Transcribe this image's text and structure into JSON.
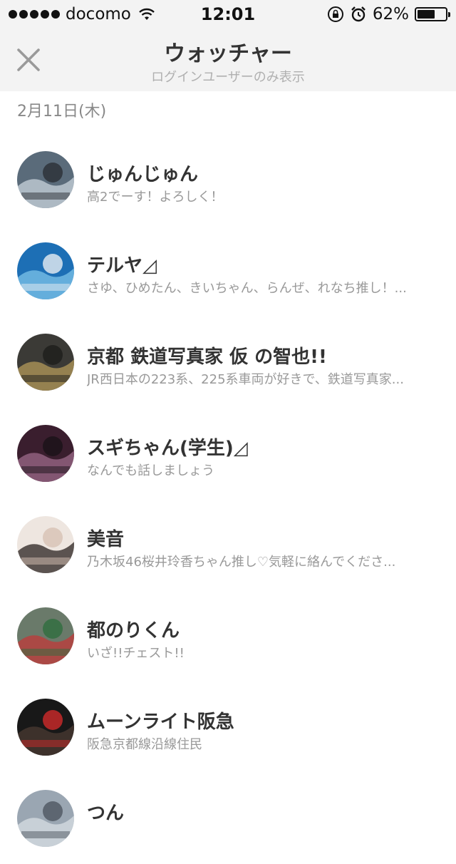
{
  "status_bar": {
    "carrier": "docomo",
    "time": "12:01",
    "battery_percent": "62%",
    "battery_level": 0.62,
    "icons": [
      "signal-dots-icon",
      "wifi-icon",
      "orientation-lock-icon",
      "alarm-icon",
      "battery-icon"
    ]
  },
  "header": {
    "title": "ウォッチャー",
    "subtitle": "ログインユーザーのみ表示",
    "close_icon": "close-icon"
  },
  "date_label": "2月11日(木)",
  "users": [
    {
      "name": "じゅんじゅん",
      "bio": "高2でーす！よろしく！",
      "avatar_colors": [
        "#5a6b7a",
        "#c9d3dc",
        "#2b2f36"
      ]
    },
    {
      "name": "テルヤ◿",
      "bio": "さゆ、ひめたん、きいちゃん、らんぜ、れなち推し！...",
      "avatar_colors": [
        "#1d6fb5",
        "#7cc3ea",
        "#e9eef2"
      ]
    },
    {
      "name": "京都 鉄道写真家 仮 の智也!!",
      "bio": "JR西日本の223系、225系車両が好きで、鉄道写真家...",
      "avatar_colors": [
        "#3b3a36",
        "#b49a5a",
        "#1e1e1c"
      ]
    },
    {
      "name": "スギちゃん(学生)◿",
      "bio": "なんでも話しましょう",
      "avatar_colors": [
        "#3a1e2e",
        "#9c6a8a",
        "#1a1218"
      ]
    },
    {
      "name": "美音",
      "bio": "乃木坂46桜井玲香ちゃん推し♡気軽に絡んでくださ...",
      "avatar_colors": [
        "#eee6e0",
        "#2a2220",
        "#d7c2b4"
      ]
    },
    {
      "name": "都のりくん",
      "bio": "いざ!!チェスト!!",
      "avatar_colors": [
        "#6a7a6a",
        "#c23a3a",
        "#2f6e3f"
      ]
    },
    {
      "name": "ムーンライト阪急",
      "bio": "阪急京都線沿線住民",
      "avatar_colors": [
        "#181818",
        "#4a3a32",
        "#cf2a2a"
      ]
    },
    {
      "name": "つん",
      "bio": "",
      "avatar_colors": [
        "#9aa6b2",
        "#d7dde3",
        "#4d5660"
      ]
    }
  ]
}
